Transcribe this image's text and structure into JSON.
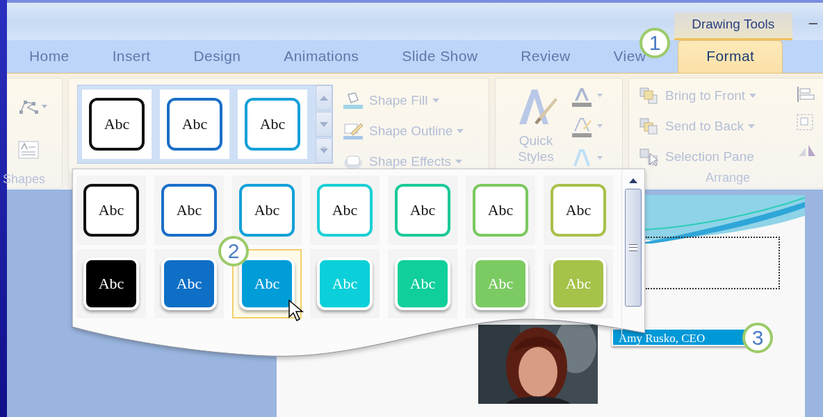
{
  "window": {
    "contextual_tab": "Drawing Tools",
    "minimize": "–"
  },
  "tabs": [
    {
      "label": "Home",
      "selected": false
    },
    {
      "label": "Insert",
      "selected": false
    },
    {
      "label": "Design",
      "selected": false
    },
    {
      "label": "Animations",
      "selected": false
    },
    {
      "label": "Slide Show",
      "selected": false
    },
    {
      "label": "Review",
      "selected": false
    },
    {
      "label": "View",
      "selected": false
    },
    {
      "label": "Format",
      "selected": true
    }
  ],
  "shapes_group": {
    "label": "Shapes"
  },
  "shape_styles": {
    "gallery": [
      {
        "text": "Abc",
        "kind": "outline",
        "color": "#111111"
      },
      {
        "text": "Abc",
        "kind": "outline",
        "color": "#1a6fc8"
      },
      {
        "text": "Abc",
        "kind": "outline",
        "color": "#14a0d8"
      }
    ],
    "commands": [
      {
        "label": "Shape Fill",
        "kind": "fill"
      },
      {
        "label": "Shape Outline",
        "kind": "outline"
      },
      {
        "label": "Shape Effects",
        "kind": "effects"
      }
    ]
  },
  "wordart": {
    "quick_styles": "Quick Styles"
  },
  "arrange": {
    "label": "Arrange",
    "commands": [
      {
        "label": "Bring to Front",
        "kind": "front"
      },
      {
        "label": "Send to Back",
        "kind": "back"
      },
      {
        "label": "Selection Pane",
        "kind": "pane"
      }
    ]
  },
  "dropdown": {
    "rows": [
      [
        {
          "text": "Abc",
          "kind": "outline",
          "color": "#111111",
          "selected": false
        },
        {
          "text": "Abc",
          "kind": "outline",
          "color": "#1a6fc8",
          "selected": false
        },
        {
          "text": "Abc",
          "kind": "outline",
          "color": "#14a0d8",
          "selected": false
        },
        {
          "text": "Abc",
          "kind": "outline",
          "color": "#1ccfd6",
          "selected": false
        },
        {
          "text": "Abc",
          "kind": "outline",
          "color": "#1cc999",
          "selected": false
        },
        {
          "text": "Abc",
          "kind": "outline",
          "color": "#7cc85e",
          "selected": false
        },
        {
          "text": "Abc",
          "kind": "outline",
          "color": "#a8c14a",
          "selected": false
        }
      ],
      [
        {
          "text": "Abc",
          "kind": "filled",
          "color": "#000000",
          "selected": false
        },
        {
          "text": "Abc",
          "kind": "filled",
          "color": "#0f6fc6",
          "selected": false
        },
        {
          "text": "Abc",
          "kind": "filled",
          "color": "#009dd9",
          "selected": true
        },
        {
          "text": "Abc",
          "kind": "filled",
          "color": "#0bd0d9",
          "selected": false
        },
        {
          "text": "Abc",
          "kind": "filled",
          "color": "#10cf9b",
          "selected": false
        },
        {
          "text": "Abc",
          "kind": "filled",
          "color": "#7cca62",
          "selected": false
        },
        {
          "text": "Abc",
          "kind": "filled",
          "color": "#a5c249",
          "selected": false
        }
      ]
    ]
  },
  "callouts": [
    {
      "number": "1"
    },
    {
      "number": "2"
    },
    {
      "number": "3"
    }
  ],
  "slide": {
    "name_label": "Amy Rusko, CEO"
  }
}
